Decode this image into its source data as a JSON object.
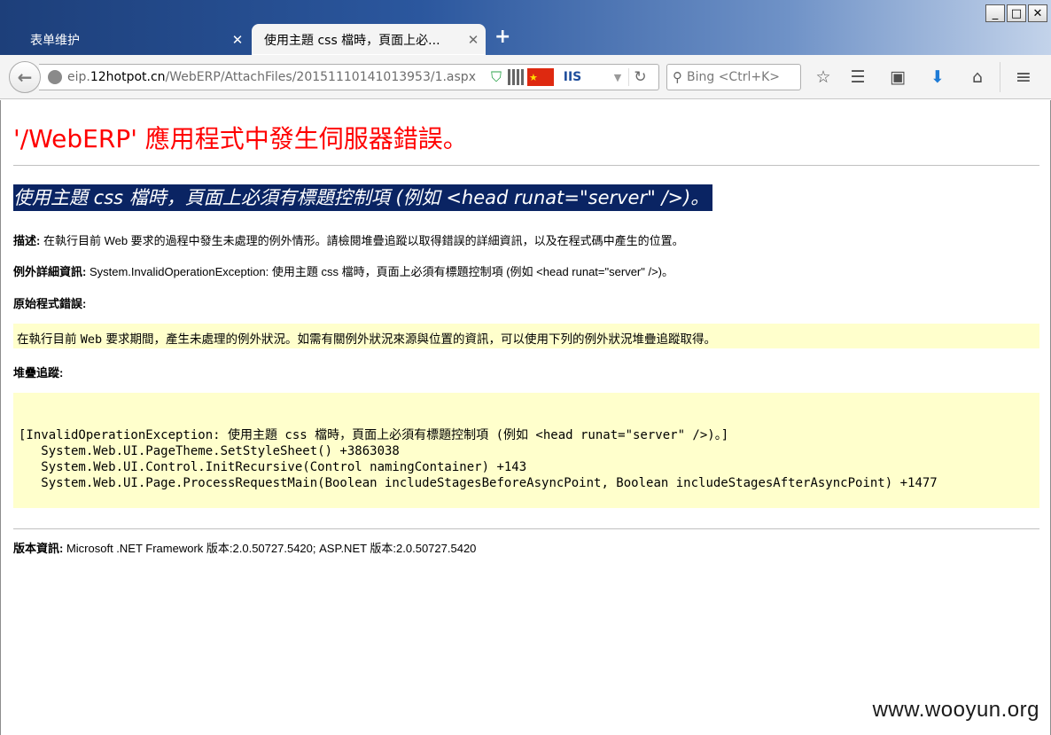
{
  "window": {
    "minimize": "_",
    "maximize": "□",
    "close": "✕"
  },
  "tabs": [
    {
      "label": "表单维护",
      "close": "✕"
    },
    {
      "label": "使用主題 css 檔時，頁面上必...",
      "close": "✕"
    }
  ],
  "new_tab": "+",
  "navbar": {
    "url_prefix": "eip.",
    "url_host": "12hotpot.cn",
    "url_path": "/WebERP/AttachFiles/20151110141013953/1.aspx",
    "url_icons": {
      "iis": "IIS",
      "flag": "★"
    },
    "search_placeholder": "Bing <Ctrl+K>",
    "icons": [
      "back-arrow-icon",
      "site-info-icon",
      "shield-icon",
      "qr-code-icon",
      "cn-flag-icon",
      "iis-icon",
      "windows-icon",
      "dropdown-icon",
      "reload-icon",
      "search-icon",
      "bookmark-star-icon",
      "reading-list-icon",
      "addon-icon",
      "download-icon",
      "home-icon",
      "menu-icon"
    ]
  },
  "page": {
    "title": "'/WebERP' 應用程式中發生伺服器錯誤。",
    "subtitle": "使用主題 css 檔時，頁面上必須有標題控制項 (例如 <head runat=\"server\" />)。",
    "description_label": "描述:",
    "description": " 在執行目前 Web 要求的過程中發生未處理的例外情形。請檢閱堆疊追蹤以取得錯誤的詳細資訊，以及在程式碼中產生的位置。",
    "exception_label": "例外詳細資訊:",
    "exception": " System.InvalidOperationException: 使用主題 css 檔時，頁面上必須有標題控制項 (例如 <head runat=\"server\" />)。",
    "source_error_label": "原始程式錯誤:",
    "source_error_pre": "在執行目前 ",
    "source_error_code": "Web",
    "source_error_post": " 要求期間，產生未處理的例外狀況。如需有關例外狀況來源與位置的資訊，可以使用下列的例外狀況堆疊追蹤取得。",
    "stack_label": "堆疊追蹤:",
    "stack_trace": "[InvalidOperationException: 使用主題 css 檔時，頁面上必須有標題控制項 (例如 <head runat=\"server\" />)。]\n   System.Web.UI.PageTheme.SetStyleSheet() +3863038\n   System.Web.UI.Control.InitRecursive(Control namingContainer) +143\n   System.Web.UI.Page.ProcessRequestMain(Boolean includeStagesBeforeAsyncPoint, Boolean includeStagesAfterAsyncPoint) +1477",
    "version_label": "版本資訊:",
    "version": " Microsoft .NET Framework 版本:2.0.50727.5420; ASP.NET 版本:2.0.50727.5420"
  },
  "watermark": "www.wooyun.org",
  "colors": {
    "title_red": "#ff0000",
    "subtitle_bg": "#0a2463",
    "code_box_bg": "#ffffcc"
  }
}
